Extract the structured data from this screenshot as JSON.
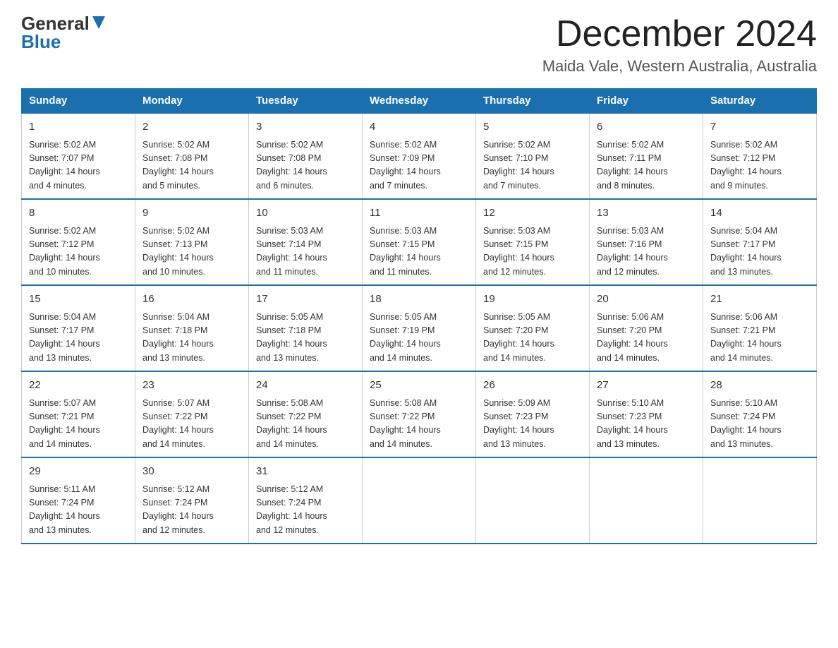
{
  "header": {
    "logo_general": "General",
    "logo_blue": "Blue",
    "title": "December 2024",
    "subtitle": "Maida Vale, Western Australia, Australia"
  },
  "days_of_week": [
    "Sunday",
    "Monday",
    "Tuesday",
    "Wednesday",
    "Thursday",
    "Friday",
    "Saturday"
  ],
  "weeks": [
    [
      {
        "day": "1",
        "sunrise": "5:02 AM",
        "sunset": "7:07 PM",
        "daylight": "14 hours and 4 minutes."
      },
      {
        "day": "2",
        "sunrise": "5:02 AM",
        "sunset": "7:08 PM",
        "daylight": "14 hours and 5 minutes."
      },
      {
        "day": "3",
        "sunrise": "5:02 AM",
        "sunset": "7:08 PM",
        "daylight": "14 hours and 6 minutes."
      },
      {
        "day": "4",
        "sunrise": "5:02 AM",
        "sunset": "7:09 PM",
        "daylight": "14 hours and 7 minutes."
      },
      {
        "day": "5",
        "sunrise": "5:02 AM",
        "sunset": "7:10 PM",
        "daylight": "14 hours and 7 minutes."
      },
      {
        "day": "6",
        "sunrise": "5:02 AM",
        "sunset": "7:11 PM",
        "daylight": "14 hours and 8 minutes."
      },
      {
        "day": "7",
        "sunrise": "5:02 AM",
        "sunset": "7:12 PM",
        "daylight": "14 hours and 9 minutes."
      }
    ],
    [
      {
        "day": "8",
        "sunrise": "5:02 AM",
        "sunset": "7:12 PM",
        "daylight": "14 hours and 10 minutes."
      },
      {
        "day": "9",
        "sunrise": "5:02 AM",
        "sunset": "7:13 PM",
        "daylight": "14 hours and 10 minutes."
      },
      {
        "day": "10",
        "sunrise": "5:03 AM",
        "sunset": "7:14 PM",
        "daylight": "14 hours and 11 minutes."
      },
      {
        "day": "11",
        "sunrise": "5:03 AM",
        "sunset": "7:15 PM",
        "daylight": "14 hours and 11 minutes."
      },
      {
        "day": "12",
        "sunrise": "5:03 AM",
        "sunset": "7:15 PM",
        "daylight": "14 hours and 12 minutes."
      },
      {
        "day": "13",
        "sunrise": "5:03 AM",
        "sunset": "7:16 PM",
        "daylight": "14 hours and 12 minutes."
      },
      {
        "day": "14",
        "sunrise": "5:04 AM",
        "sunset": "7:17 PM",
        "daylight": "14 hours and 13 minutes."
      }
    ],
    [
      {
        "day": "15",
        "sunrise": "5:04 AM",
        "sunset": "7:17 PM",
        "daylight": "14 hours and 13 minutes."
      },
      {
        "day": "16",
        "sunrise": "5:04 AM",
        "sunset": "7:18 PM",
        "daylight": "14 hours and 13 minutes."
      },
      {
        "day": "17",
        "sunrise": "5:05 AM",
        "sunset": "7:18 PM",
        "daylight": "14 hours and 13 minutes."
      },
      {
        "day": "18",
        "sunrise": "5:05 AM",
        "sunset": "7:19 PM",
        "daylight": "14 hours and 14 minutes."
      },
      {
        "day": "19",
        "sunrise": "5:05 AM",
        "sunset": "7:20 PM",
        "daylight": "14 hours and 14 minutes."
      },
      {
        "day": "20",
        "sunrise": "5:06 AM",
        "sunset": "7:20 PM",
        "daylight": "14 hours and 14 minutes."
      },
      {
        "day": "21",
        "sunrise": "5:06 AM",
        "sunset": "7:21 PM",
        "daylight": "14 hours and 14 minutes."
      }
    ],
    [
      {
        "day": "22",
        "sunrise": "5:07 AM",
        "sunset": "7:21 PM",
        "daylight": "14 hours and 14 minutes."
      },
      {
        "day": "23",
        "sunrise": "5:07 AM",
        "sunset": "7:22 PM",
        "daylight": "14 hours and 14 minutes."
      },
      {
        "day": "24",
        "sunrise": "5:08 AM",
        "sunset": "7:22 PM",
        "daylight": "14 hours and 14 minutes."
      },
      {
        "day": "25",
        "sunrise": "5:08 AM",
        "sunset": "7:22 PM",
        "daylight": "14 hours and 14 minutes."
      },
      {
        "day": "26",
        "sunrise": "5:09 AM",
        "sunset": "7:23 PM",
        "daylight": "14 hours and 13 minutes."
      },
      {
        "day": "27",
        "sunrise": "5:10 AM",
        "sunset": "7:23 PM",
        "daylight": "14 hours and 13 minutes."
      },
      {
        "day": "28",
        "sunrise": "5:10 AM",
        "sunset": "7:24 PM",
        "daylight": "14 hours and 13 minutes."
      }
    ],
    [
      {
        "day": "29",
        "sunrise": "5:11 AM",
        "sunset": "7:24 PM",
        "daylight": "14 hours and 13 minutes."
      },
      {
        "day": "30",
        "sunrise": "5:12 AM",
        "sunset": "7:24 PM",
        "daylight": "14 hours and 12 minutes."
      },
      {
        "day": "31",
        "sunrise": "5:12 AM",
        "sunset": "7:24 PM",
        "daylight": "14 hours and 12 minutes."
      },
      null,
      null,
      null,
      null
    ]
  ],
  "labels": {
    "sunrise": "Sunrise:",
    "sunset": "Sunset:",
    "daylight": "Daylight:"
  }
}
